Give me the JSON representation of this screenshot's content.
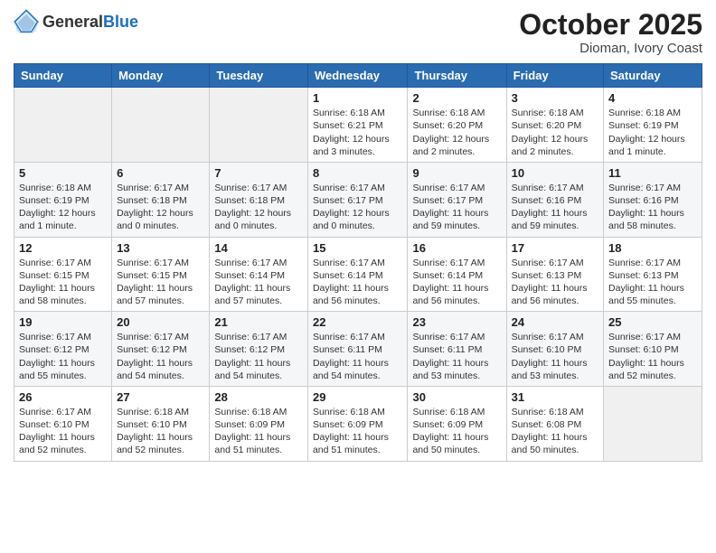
{
  "header": {
    "logo_general": "General",
    "logo_blue": "Blue",
    "title": "October 2025",
    "subtitle": "Dioman, Ivory Coast"
  },
  "days_of_week": [
    "Sunday",
    "Monday",
    "Tuesday",
    "Wednesday",
    "Thursday",
    "Friday",
    "Saturday"
  ],
  "weeks": [
    [
      {
        "day": "",
        "info": ""
      },
      {
        "day": "",
        "info": ""
      },
      {
        "day": "",
        "info": ""
      },
      {
        "day": "1",
        "info": "Sunrise: 6:18 AM\nSunset: 6:21 PM\nDaylight: 12 hours and 3 minutes."
      },
      {
        "day": "2",
        "info": "Sunrise: 6:18 AM\nSunset: 6:20 PM\nDaylight: 12 hours and 2 minutes."
      },
      {
        "day": "3",
        "info": "Sunrise: 6:18 AM\nSunset: 6:20 PM\nDaylight: 12 hours and 2 minutes."
      },
      {
        "day": "4",
        "info": "Sunrise: 6:18 AM\nSunset: 6:19 PM\nDaylight: 12 hours and 1 minute."
      }
    ],
    [
      {
        "day": "5",
        "info": "Sunrise: 6:18 AM\nSunset: 6:19 PM\nDaylight: 12 hours and 1 minute."
      },
      {
        "day": "6",
        "info": "Sunrise: 6:17 AM\nSunset: 6:18 PM\nDaylight: 12 hours and 0 minutes."
      },
      {
        "day": "7",
        "info": "Sunrise: 6:17 AM\nSunset: 6:18 PM\nDaylight: 12 hours and 0 minutes."
      },
      {
        "day": "8",
        "info": "Sunrise: 6:17 AM\nSunset: 6:17 PM\nDaylight: 12 hours and 0 minutes."
      },
      {
        "day": "9",
        "info": "Sunrise: 6:17 AM\nSunset: 6:17 PM\nDaylight: 11 hours and 59 minutes."
      },
      {
        "day": "10",
        "info": "Sunrise: 6:17 AM\nSunset: 6:16 PM\nDaylight: 11 hours and 59 minutes."
      },
      {
        "day": "11",
        "info": "Sunrise: 6:17 AM\nSunset: 6:16 PM\nDaylight: 11 hours and 58 minutes."
      }
    ],
    [
      {
        "day": "12",
        "info": "Sunrise: 6:17 AM\nSunset: 6:15 PM\nDaylight: 11 hours and 58 minutes."
      },
      {
        "day": "13",
        "info": "Sunrise: 6:17 AM\nSunset: 6:15 PM\nDaylight: 11 hours and 57 minutes."
      },
      {
        "day": "14",
        "info": "Sunrise: 6:17 AM\nSunset: 6:14 PM\nDaylight: 11 hours and 57 minutes."
      },
      {
        "day": "15",
        "info": "Sunrise: 6:17 AM\nSunset: 6:14 PM\nDaylight: 11 hours and 56 minutes."
      },
      {
        "day": "16",
        "info": "Sunrise: 6:17 AM\nSunset: 6:14 PM\nDaylight: 11 hours and 56 minutes."
      },
      {
        "day": "17",
        "info": "Sunrise: 6:17 AM\nSunset: 6:13 PM\nDaylight: 11 hours and 56 minutes."
      },
      {
        "day": "18",
        "info": "Sunrise: 6:17 AM\nSunset: 6:13 PM\nDaylight: 11 hours and 55 minutes."
      }
    ],
    [
      {
        "day": "19",
        "info": "Sunrise: 6:17 AM\nSunset: 6:12 PM\nDaylight: 11 hours and 55 minutes."
      },
      {
        "day": "20",
        "info": "Sunrise: 6:17 AM\nSunset: 6:12 PM\nDaylight: 11 hours and 54 minutes."
      },
      {
        "day": "21",
        "info": "Sunrise: 6:17 AM\nSunset: 6:12 PM\nDaylight: 11 hours and 54 minutes."
      },
      {
        "day": "22",
        "info": "Sunrise: 6:17 AM\nSunset: 6:11 PM\nDaylight: 11 hours and 54 minutes."
      },
      {
        "day": "23",
        "info": "Sunrise: 6:17 AM\nSunset: 6:11 PM\nDaylight: 11 hours and 53 minutes."
      },
      {
        "day": "24",
        "info": "Sunrise: 6:17 AM\nSunset: 6:10 PM\nDaylight: 11 hours and 53 minutes."
      },
      {
        "day": "25",
        "info": "Sunrise: 6:17 AM\nSunset: 6:10 PM\nDaylight: 11 hours and 52 minutes."
      }
    ],
    [
      {
        "day": "26",
        "info": "Sunrise: 6:17 AM\nSunset: 6:10 PM\nDaylight: 11 hours and 52 minutes."
      },
      {
        "day": "27",
        "info": "Sunrise: 6:18 AM\nSunset: 6:10 PM\nDaylight: 11 hours and 52 minutes."
      },
      {
        "day": "28",
        "info": "Sunrise: 6:18 AM\nSunset: 6:09 PM\nDaylight: 11 hours and 51 minutes."
      },
      {
        "day": "29",
        "info": "Sunrise: 6:18 AM\nSunset: 6:09 PM\nDaylight: 11 hours and 51 minutes."
      },
      {
        "day": "30",
        "info": "Sunrise: 6:18 AM\nSunset: 6:09 PM\nDaylight: 11 hours and 50 minutes."
      },
      {
        "day": "31",
        "info": "Sunrise: 6:18 AM\nSunset: 6:08 PM\nDaylight: 11 hours and 50 minutes."
      },
      {
        "day": "",
        "info": ""
      }
    ]
  ]
}
